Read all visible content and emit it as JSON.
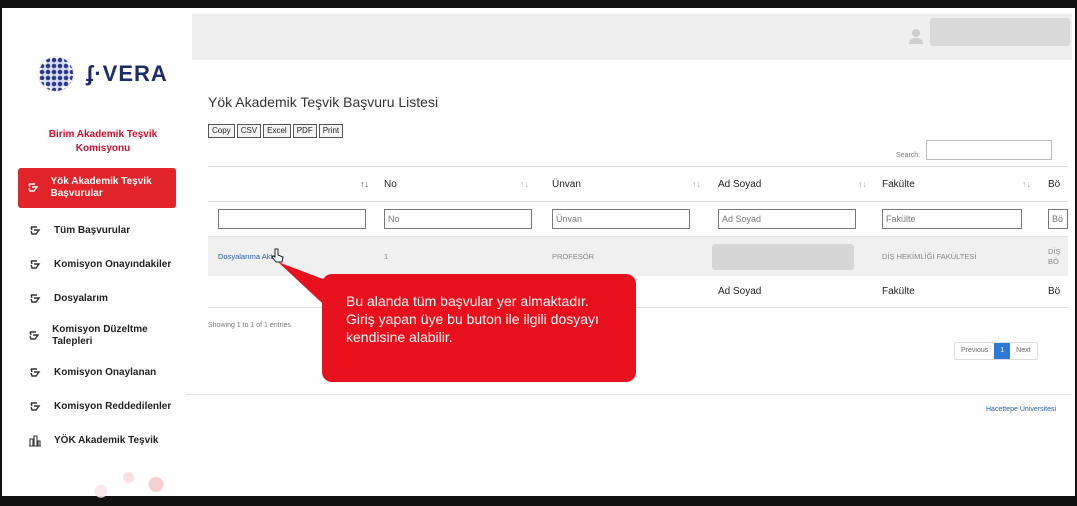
{
  "brand": {
    "logo_text": "ʄ·VERA",
    "logo_icon": "vera-dots-logo"
  },
  "sidebar": {
    "unit_title": "Birim Akademik Teşvik Komisyonu",
    "items": [
      {
        "label": "Yök Akademik Teşvik Başvurular",
        "icon": "hand-icon",
        "active": true
      },
      {
        "label": "Tüm Başvurular",
        "icon": "hand-icon"
      },
      {
        "label": "Komisyon Onayındakiler",
        "icon": "hand-icon"
      },
      {
        "label": "Dosyalarım",
        "icon": "hand-icon"
      },
      {
        "label": "Komisyon Düzeltme Talepleri",
        "icon": "hand-icon"
      },
      {
        "label": "Komisyon Onaylanan",
        "icon": "hand-icon"
      },
      {
        "label": "Komisyon Reddedilenler",
        "icon": "hand-icon"
      },
      {
        "label": "YÖK Akademik Teşvik",
        "icon": "chart-icon"
      }
    ]
  },
  "header": {
    "user_icon": "user-icon"
  },
  "main": {
    "title": "Yök Akademik Teşvik Başvuru Listesi",
    "export_buttons": [
      "Copy",
      "CSV",
      "Excel",
      "PDF",
      "Print"
    ],
    "search_label": "Search:",
    "search_value": "",
    "columns": [
      "",
      "No",
      "Ünvan",
      "Ad Soyad",
      "Fakülte",
      "Bö"
    ],
    "filter_placeholders": [
      "",
      "No",
      "Ünvan",
      "Ad Soyad",
      "Fakülte",
      "Bö"
    ],
    "rows": [
      {
        "action": "Dosyalarıma Aktar",
        "no": "1",
        "unvan": "PROFESÖR",
        "ad_soyad": "",
        "fakulte": "DİŞ HEKİMLİĞİ FAKÜLTESİ",
        "bolum": "DİŞ BÖ"
      }
    ],
    "footer_columns": [
      "",
      "",
      "",
      "Ad Soyad",
      "Fakülte",
      "Bö"
    ],
    "showing_text": "Showing 1 to 1 of 1 entries",
    "pager": {
      "previous": "Previous",
      "current": "1",
      "next": "Next"
    }
  },
  "footer": {
    "university": "Hacettepe Üniversitesi"
  },
  "callout": {
    "text": "Bu alanda tüm başvular yer almaktadır. Giriş yapan üye bu buton ile ilgili dosyayı kendisine alabilir."
  },
  "colors": {
    "accent_red": "#e0242a",
    "callout_red": "#e8101c",
    "brand_blue": "#1f2a6b",
    "link_blue": "#2a5db0",
    "pager_blue": "#2d79d4"
  }
}
